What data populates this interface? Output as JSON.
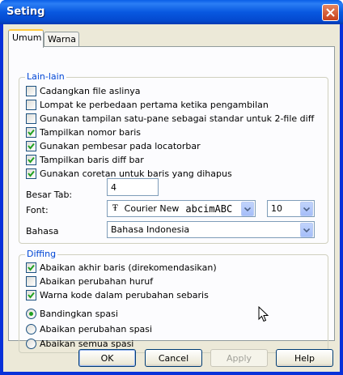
{
  "window": {
    "title": "Seting"
  },
  "tabs": [
    {
      "label": "Umum",
      "active": true
    },
    {
      "label": "Warna",
      "active": false
    }
  ],
  "lain_lain": {
    "title": "Lain-lain",
    "options": [
      {
        "label": "Cadangkan file aslinya",
        "checked": false
      },
      {
        "label": "Lompat ke perbedaan pertama ketika pengambilan",
        "checked": false
      },
      {
        "label": "Gunakan tampilan satu-pane sebagai standar untuk 2-file diff",
        "checked": false
      },
      {
        "label": "Tampilkan nomor baris",
        "checked": true
      },
      {
        "label": "Gunakan pembesar pada locatorbar",
        "checked": true
      },
      {
        "label": "Tampilkan baris diff bar",
        "checked": true
      },
      {
        "label": "Gunakan coretan untuk baris yang dihapus",
        "checked": true
      }
    ],
    "tab_label": "Besar Tab:",
    "tab_value": "4",
    "font_label": "Font:",
    "font_name": "Courier New",
    "font_sample": "abcimABC",
    "font_size": "10",
    "language_label": "Bahasa",
    "language_value": "Bahasa Indonesia"
  },
  "diffing": {
    "title": "Diffing",
    "options": [
      {
        "label": "Abaikan akhir baris (direkomendasikan)",
        "checked": true
      },
      {
        "label": "Abaikan perubahan huruf",
        "checked": false
      },
      {
        "label": "Warna kode dalam perubahan sebaris",
        "checked": true
      }
    ],
    "spacing": [
      {
        "label": "Bandingkan spasi",
        "selected": true
      },
      {
        "label": "Abaikan perubahan spasi",
        "selected": false
      },
      {
        "label": "Abaikan semua spasi",
        "selected": false
      }
    ]
  },
  "buttons": {
    "ok": "OK",
    "cancel": "Cancel",
    "apply": "Apply",
    "help": "Help"
  },
  "colors": {
    "titlebar": "#0858e0",
    "group_label": "#0046d5",
    "check": "#21a121",
    "close": "#c8401b"
  },
  "icons": [
    "close-icon",
    "check-icon",
    "truetype-font-icon",
    "chevron-down-icon",
    "mouse-pointer-icon"
  ]
}
